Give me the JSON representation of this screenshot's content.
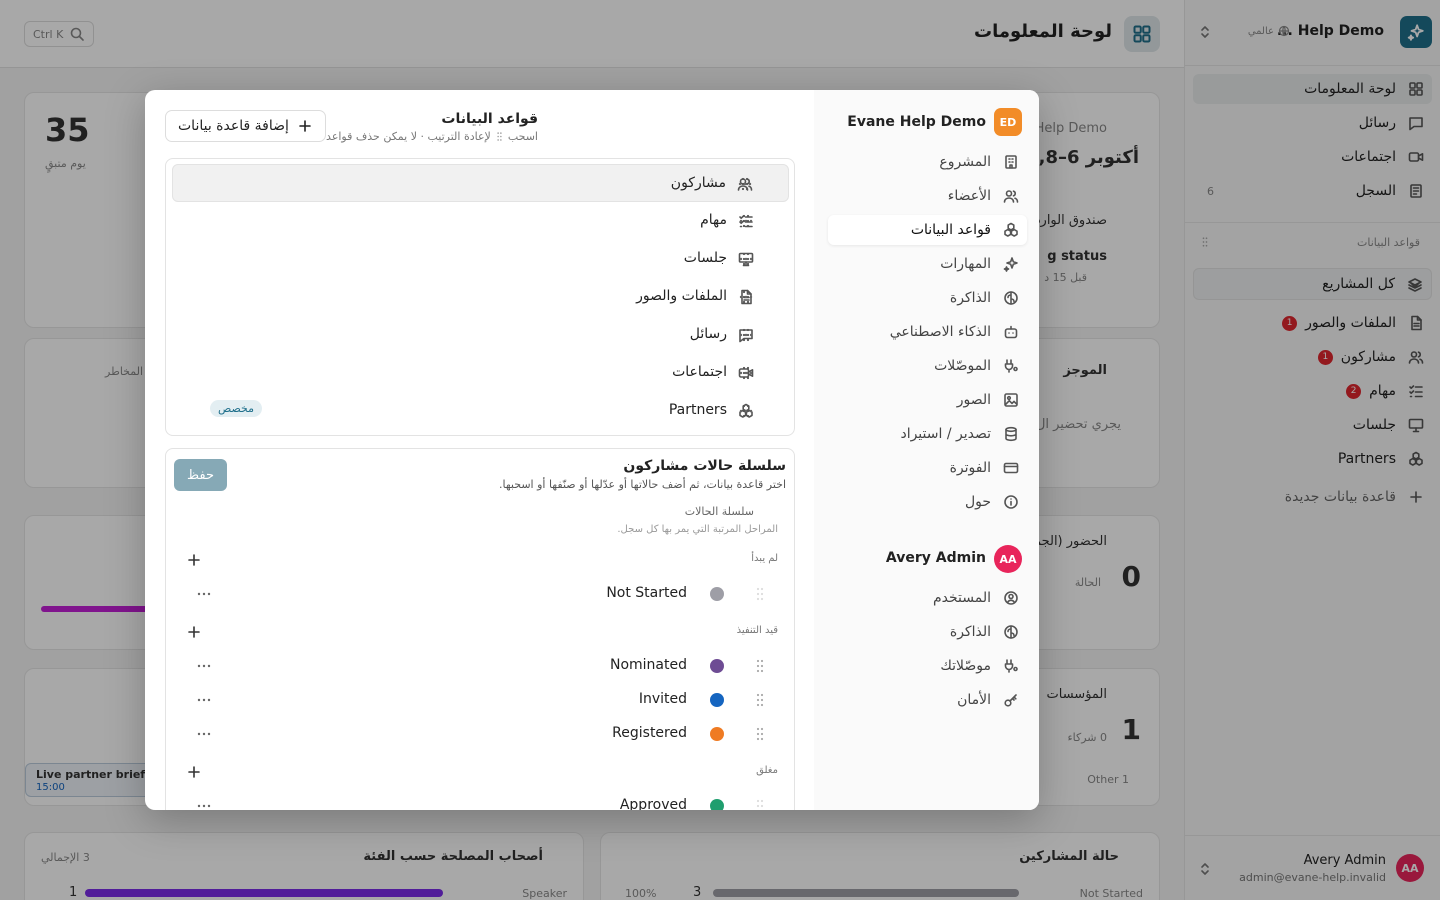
{
  "background": {
    "search_shortcut": "Ctrl K",
    "page_title": "لوحة المعلومات",
    "stat_value": "35",
    "stat_label": "يوم متبقٍ",
    "project_name": "Help Demo",
    "date_range": "أكتوبر 6–8,",
    "inbox_label": "صندوق الوارد",
    "status_text": "g status",
    "time_ago": "قبل 15 د",
    "brief_label": "الموجز",
    "brief_text": "يجري تحضير ال",
    "risks_label": "المخاطر",
    "attendance_label": "الحضور (الجمه",
    "attendance_value": "0",
    "attendance_sub": "الحالة",
    "orgs_label": "المؤسسات",
    "orgs_value": "1",
    "orgs_sub": "0 شركاء",
    "orgs_other": "1 Other",
    "event_title": "Live partner briefi",
    "event_time": "15:00",
    "stakeholders_title": "أصحاب المصلحة حسب الفئة",
    "stakeholders_total": "3 الإجمالي",
    "stakeholders_row_label": "Speaker",
    "stakeholders_row_value": "1",
    "participants_title": "حالة المشاركين",
    "participants_row_label": "Not Started",
    "participants_row_value": "3",
    "participants_row_pct": "100%"
  },
  "sidebar": {
    "workspace_name": "Help Demo ...",
    "workspace_scope": "عالمي",
    "nav": [
      {
        "label": "لوحة المعلومات",
        "icon": "dashboard-icon"
      },
      {
        "label": "رسائل",
        "icon": "message-icon"
      },
      {
        "label": "اجتماعات",
        "icon": "video-icon"
      },
      {
        "label": "السجل",
        "icon": "log-icon",
        "count": "6"
      }
    ],
    "section_label": "قواعد البيانات",
    "project_selector": "كل المشاريع",
    "databases": [
      {
        "label": "الملفات والصور",
        "badge": "1"
      },
      {
        "label": "مشاركون",
        "badge": "1"
      },
      {
        "label": "مهام",
        "badge": "2"
      },
      {
        "label": "جلسات"
      },
      {
        "label": "Partners"
      }
    ],
    "new_database": "قاعدة بيانات جديدة",
    "user": {
      "initials": "AA",
      "name": "Avery Admin",
      "email": "admin@evane-help.invalid"
    }
  },
  "modal": {
    "workspace": {
      "initials": "ED",
      "name": "Evane Help Demo"
    },
    "workspace_items": [
      "المشروع",
      "الأعضاء",
      "قواعد البيانات",
      "المهارات",
      "الذاكرة",
      "الذكاء الاصطناعي",
      "الموصّلات",
      "الصور",
      "تصدير / استيراد",
      "الفوترة",
      "حول"
    ],
    "user": {
      "initials": "AA",
      "name": "Avery Admin"
    },
    "user_items": [
      "المستخدم",
      "الذاكرة",
      "موصّلاتك",
      "الأمان"
    ],
    "title": "قواعد البيانات",
    "subtitle_before": "اسحب",
    "subtitle_after": "لإعادة الترتيب · لا يمكن حذف قواعد البيانات المدمجة.",
    "add_button": "إضافة قاعدة بيانات",
    "databases": [
      {
        "label": "مشاركون"
      },
      {
        "label": "مهام"
      },
      {
        "label": "جلسات"
      },
      {
        "label": "الملفات والصور"
      },
      {
        "label": "رسائل"
      },
      {
        "label": "اجتماعات"
      },
      {
        "label": "Partners",
        "tag": "مخصص"
      }
    ],
    "status_section": {
      "title": "سلسلة حالات مشاركون",
      "subtitle": "اختر قاعدة بيانات، ثم أضف حالاتها أو عدّلها أو صنّفها أو اسحبها.",
      "save": "حفظ",
      "chain_label": "سلسلة الحالات",
      "chain_sub": "المراحل المرتبة التي يمر بها كل سجل.",
      "groups": [
        {
          "label": "لم يبدأ",
          "statuses": [
            {
              "label": "Not Started",
              "color": "#9e9ea6"
            }
          ]
        },
        {
          "label": "قيد التنفيذ",
          "statuses": [
            {
              "label": "Nominated",
              "color": "#6e4c94"
            },
            {
              "label": "Invited",
              "color": "#1565c0"
            },
            {
              "label": "Registered",
              "color": "#ef7b23"
            }
          ]
        },
        {
          "label": "مغلق",
          "statuses": [
            {
              "label": "Approved",
              "color": "#1f9e6e"
            }
          ]
        }
      ]
    }
  }
}
